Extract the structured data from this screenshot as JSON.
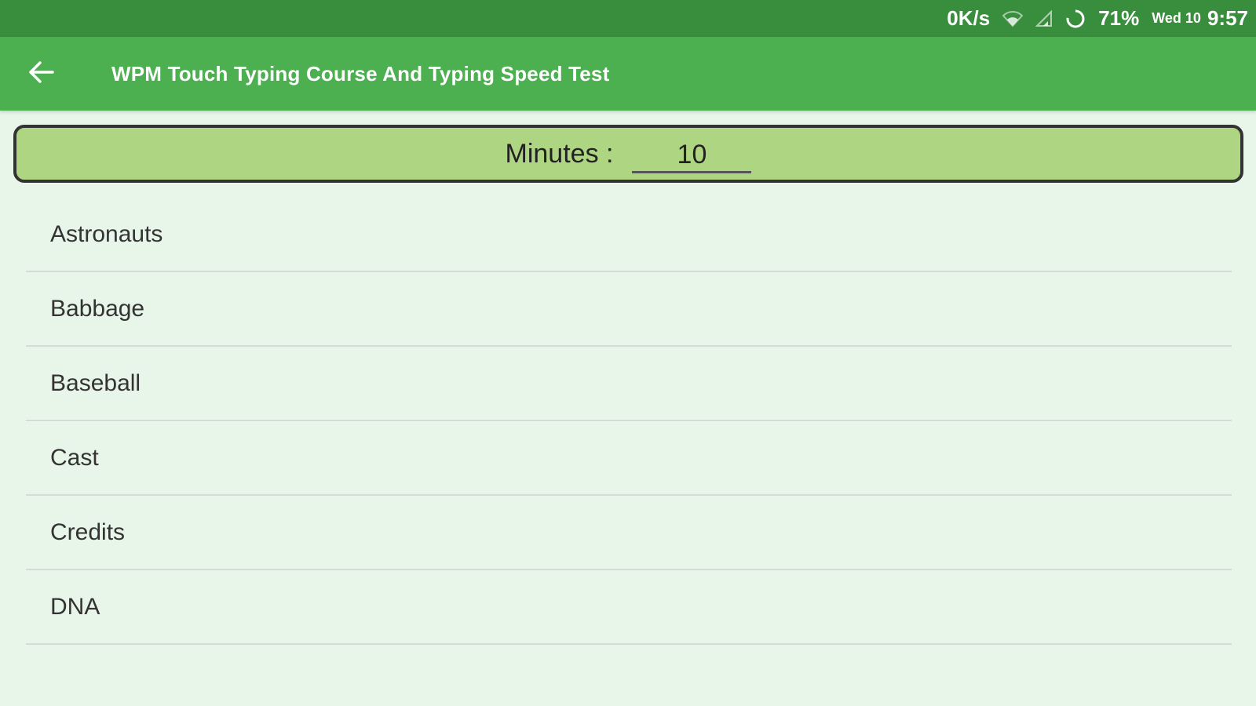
{
  "status_bar": {
    "net_speed": "0K/s",
    "battery_percent": "71%",
    "date": "Wed 10",
    "time": "9:57",
    "icons": [
      "wifi-icon",
      "signal-icon",
      "battery-icon"
    ]
  },
  "app_bar": {
    "back_icon": "arrow-left-icon",
    "title": "WPM Touch Typing Course And Typing Speed Test"
  },
  "minutes": {
    "label": "Minutes :",
    "value": "10"
  },
  "list": {
    "items": [
      {
        "label": "Astronauts"
      },
      {
        "label": "Babbage"
      },
      {
        "label": "Baseball"
      },
      {
        "label": "Cast"
      },
      {
        "label": "Credits"
      },
      {
        "label": "DNA"
      }
    ]
  },
  "colors": {
    "status_bar": "#388e3c",
    "app_bar": "#4caf50",
    "minutes_box": "#aed581",
    "background": "#e8f5e9"
  }
}
